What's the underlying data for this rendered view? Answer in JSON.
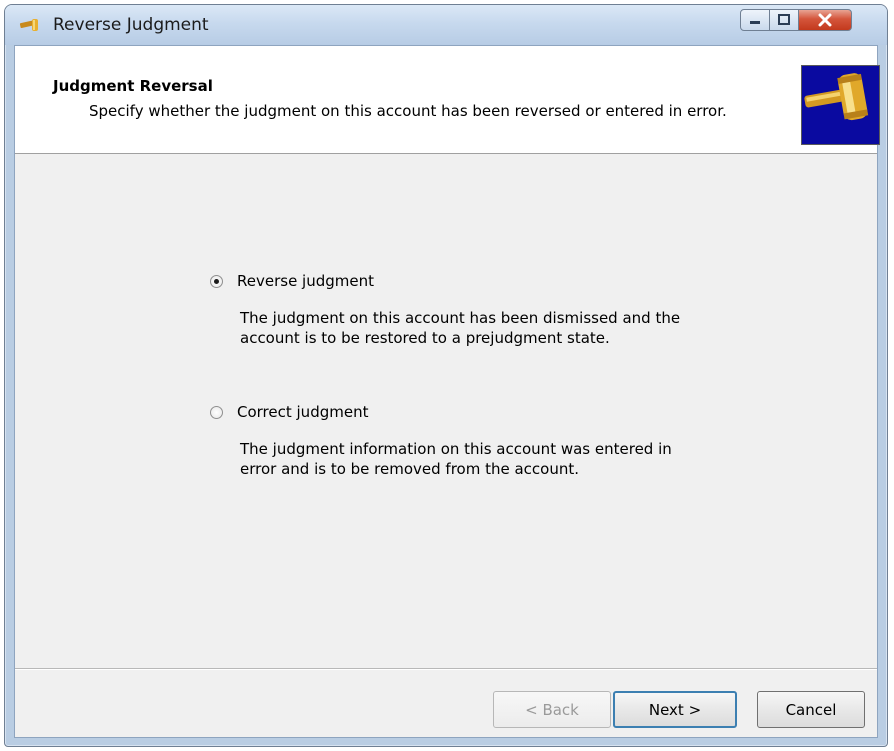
{
  "window": {
    "title": "Reverse Judgment",
    "controls": {
      "minimize": "minimize",
      "maximize": "maximize",
      "close": "close"
    }
  },
  "header": {
    "title": "Judgment Reversal",
    "subtitle": "Specify whether the judgment on this account has been reversed or entered in error.",
    "icon": "gavel-icon"
  },
  "options": [
    {
      "label": "Reverse judgment",
      "checked": true,
      "description_lines": [
        "The judgment on this account has been dismissed and the",
        "account is to be restored to a prejudgment state."
      ]
    },
    {
      "label": "Correct judgment",
      "checked": false,
      "description_lines": [
        "The judgment information on this account was entered in",
        "error and is to be removed from the account."
      ]
    }
  ],
  "buttons": {
    "back_label": "< Back",
    "next_label": "Next >",
    "cancel_label": "Cancel"
  },
  "colors": {
    "titlebar": "#c7d9ee",
    "close_button": "#c3391d",
    "gavel_background": "#0a0aa0",
    "default_button_border": "#3c7fb1"
  }
}
